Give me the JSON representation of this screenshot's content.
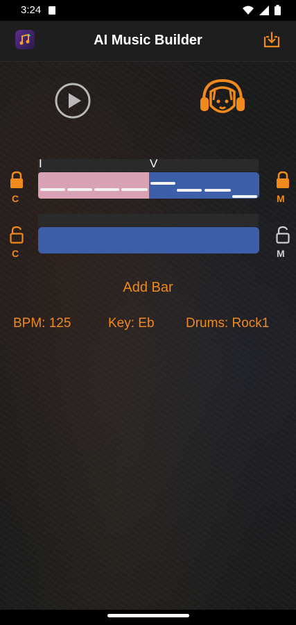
{
  "status_bar": {
    "time": "3:24"
  },
  "app_bar": {
    "title": "AI Music Builder"
  },
  "progression": {
    "markers": [
      "I",
      "V"
    ]
  },
  "tracks": [
    {
      "left_label": "C",
      "right_label": "M",
      "locked": true
    },
    {
      "left_label": "C",
      "right_label": "M",
      "locked": false
    }
  ],
  "actions": {
    "add_bar": "Add Bar"
  },
  "info": {
    "bpm": "BPM: 125",
    "key": "Key: Eb",
    "drums": "Drums: Rock1"
  },
  "colors": {
    "accent": "#f08a1c",
    "segment_pink": "#d8a2b4",
    "segment_blue": "#3d5ea8",
    "background": "#141414"
  },
  "icons": [
    "app-logo-icon",
    "download-icon",
    "play-icon",
    "dog-headphones-icon",
    "lock-icon",
    "unlock-icon",
    "wifi-icon",
    "signal-icon",
    "battery-icon"
  ]
}
